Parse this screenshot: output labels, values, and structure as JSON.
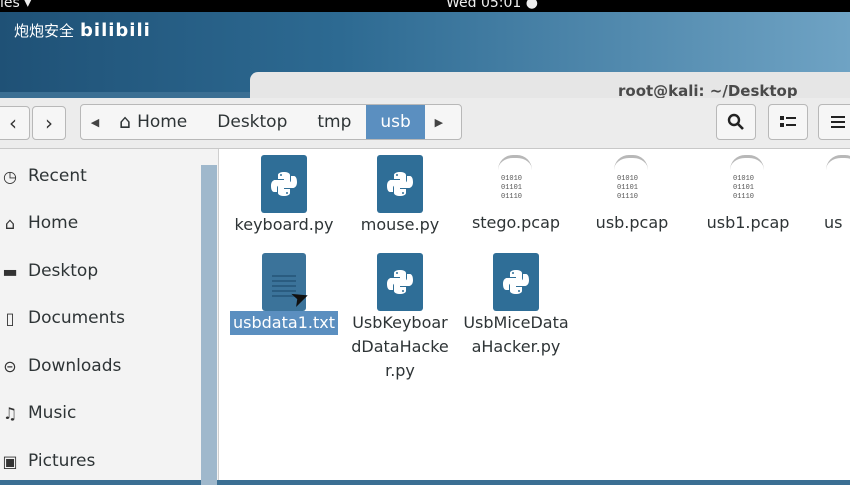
{
  "topbar": {
    "activities": "ies ▾",
    "clock": "Wed 05:01 ●"
  },
  "watermark": {
    "text": "炮炮安全",
    "brand": "bilibili"
  },
  "terminal": {
    "title": "root@kali: ~/Desktop"
  },
  "toolbar": {
    "back_icon": "‹",
    "forward_icon": "›",
    "path_left_icon": "◀",
    "path_right_icon": "▶",
    "search_icon": "search-icon",
    "view_icon": "list-view-icon",
    "menu_icon": "hamburger-menu-icon"
  },
  "breadcrumbs": [
    {
      "label": "Home"
    },
    {
      "label": "Desktop"
    },
    {
      "label": "tmp"
    },
    {
      "label": "usb",
      "active": true
    }
  ],
  "sidebar": {
    "items": [
      {
        "label": "Recent",
        "icon": "clock-icon"
      },
      {
        "label": "Home",
        "icon": "home-icon"
      },
      {
        "label": "Desktop",
        "icon": "folder-icon"
      },
      {
        "label": "Documents",
        "icon": "document-icon"
      },
      {
        "label": "Downloads",
        "icon": "download-icon"
      },
      {
        "label": "Music",
        "icon": "music-icon"
      },
      {
        "label": "Pictures",
        "icon": "camera-icon"
      }
    ]
  },
  "files": [
    {
      "name": "keyboard.py",
      "type": "python"
    },
    {
      "name": "mouse.py",
      "type": "python"
    },
    {
      "name": "stego.pcap",
      "type": "pcap"
    },
    {
      "name": "usb.pcap",
      "type": "pcap"
    },
    {
      "name": "usb1.pcap",
      "type": "pcap"
    },
    {
      "name": "us",
      "type": "pcap"
    },
    {
      "name": "usbdata1.txt",
      "type": "text",
      "selected": true
    },
    {
      "name": "UsbKeyboar",
      "name2": "dDataHacke",
      "name3": "r.py",
      "type": "python"
    },
    {
      "name": "UsbMiceData",
      "name2": "aHacker.py",
      "type": "python"
    }
  ],
  "pcap_bits": "01010\n01101\n01110"
}
